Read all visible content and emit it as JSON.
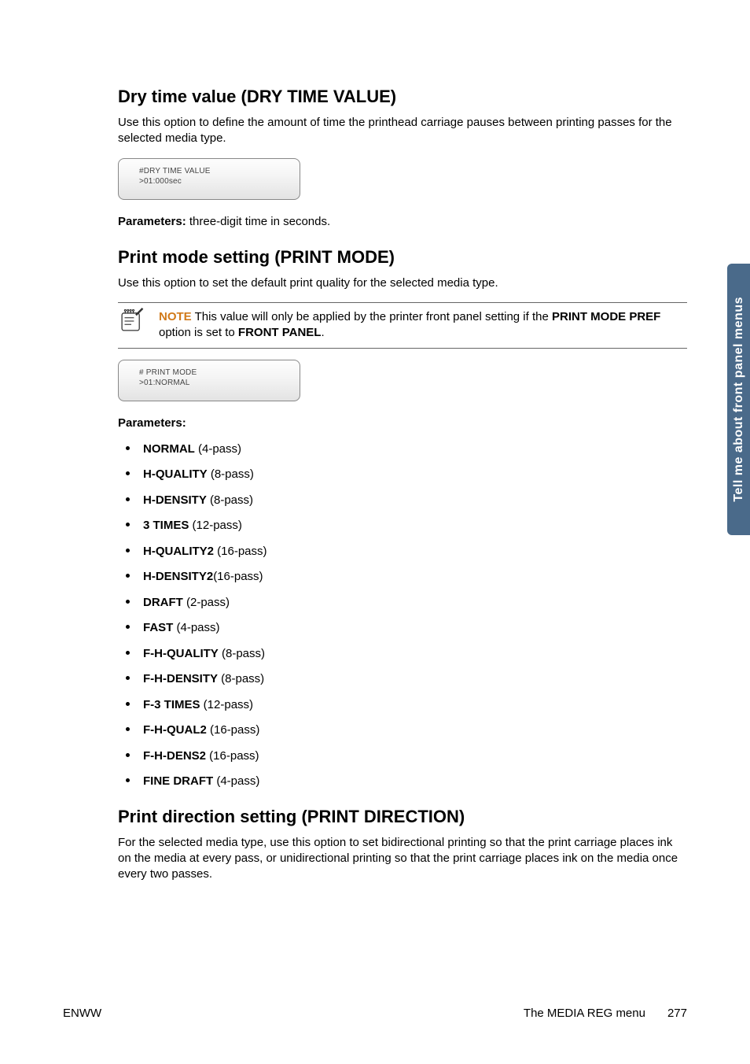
{
  "sideTab": "Tell me about front panel menus",
  "sections": {
    "dryTime": {
      "heading": "Dry time value (DRY TIME VALUE)",
      "desc": "Use this option to define the amount of time the printhead carriage pauses between printing passes for the selected media type.",
      "lcd": {
        "line1": "#DRY TIME VALUE",
        "line2": ">01:000sec"
      },
      "paramsLabel": "Parameters:",
      "paramsText": " three-digit time in seconds."
    },
    "printMode": {
      "heading": "Print mode setting (PRINT MODE)",
      "desc": "Use this option to set the default print quality for the selected media type.",
      "note": {
        "label": "NOTE",
        "pre": "   This value will only be applied by the printer front panel setting if the ",
        "bold1": "PRINT MODE PREF",
        "mid": " option is set to  ",
        "bold2": "FRONT PANEL",
        "post": "."
      },
      "lcd": {
        "line1": "# PRINT MODE",
        "line2": ">01:NORMAL"
      },
      "paramsLabel": "Parameters:",
      "items": [
        {
          "bold": "NORMAL",
          "rest": " (4-pass)"
        },
        {
          "bold": "H-QUALITY",
          "rest": " (8-pass)"
        },
        {
          "bold": "H-DENSITY",
          "rest": " (8-pass)"
        },
        {
          "bold": "3 TIMES",
          "rest": " (12-pass)"
        },
        {
          "bold": "H-QUALITY2",
          "rest": " (16-pass)"
        },
        {
          "bold": "H-DENSITY2",
          "rest": "(16-pass)"
        },
        {
          "bold": "DRAFT",
          "rest": " (2-pass)"
        },
        {
          "bold": "FAST",
          "rest": " (4-pass)"
        },
        {
          "bold": "F-H-QUALITY",
          "rest": " (8-pass)"
        },
        {
          "bold": "F-H-DENSITY",
          "rest": " (8-pass)"
        },
        {
          "bold": "F-3 TIMES",
          "rest": " (12-pass)"
        },
        {
          "bold": "F-H-QUAL2",
          "rest": " (16-pass)"
        },
        {
          "bold": "F-H-DENS2",
          "rest": " (16-pass)"
        },
        {
          "bold": "FINE DRAFT",
          "rest": " (4-pass)"
        }
      ]
    },
    "printDirection": {
      "heading": "Print direction setting (PRINT DIRECTION)",
      "desc": "For the selected media type, use this option to set bidirectional printing so that the print carriage places ink on the media at every pass, or unidirectional printing so that the print carriage places ink on the media once every two passes."
    }
  },
  "footer": {
    "left": "ENWW",
    "rightText": "The MEDIA REG menu",
    "pageNum": "277"
  }
}
